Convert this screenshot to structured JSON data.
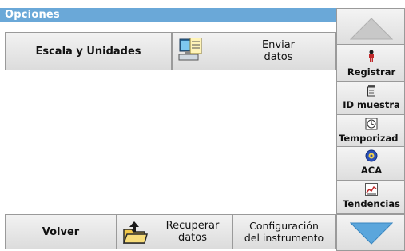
{
  "window": {
    "title": "Opciones"
  },
  "buttons": {
    "scale_units": "Escala y Unidades",
    "send_data_line1": "Enviar",
    "send_data_line2": "datos",
    "back": "Volver",
    "recover_line1": "Recuperar",
    "recover_line2": "datos",
    "config_line1": "Configuración",
    "config_line2": "del instrumento"
  },
  "sidebar": {
    "items": [
      {
        "label": "Registrar",
        "icon": "person-icon"
      },
      {
        "label": "ID muestra",
        "icon": "sample-bottle-icon"
      },
      {
        "label": "Temporizad",
        "icon": "timer-icon"
      },
      {
        "label": "ACA",
        "icon": "aca-icon"
      },
      {
        "label": "Tendencias",
        "icon": "trend-chart-icon"
      }
    ]
  },
  "colors": {
    "title_bar": "#6aa8d8",
    "arrow": "#5ba6dc",
    "button_gradient_top": "#f2f2f2",
    "button_gradient_bottom": "#dcdcdc"
  }
}
